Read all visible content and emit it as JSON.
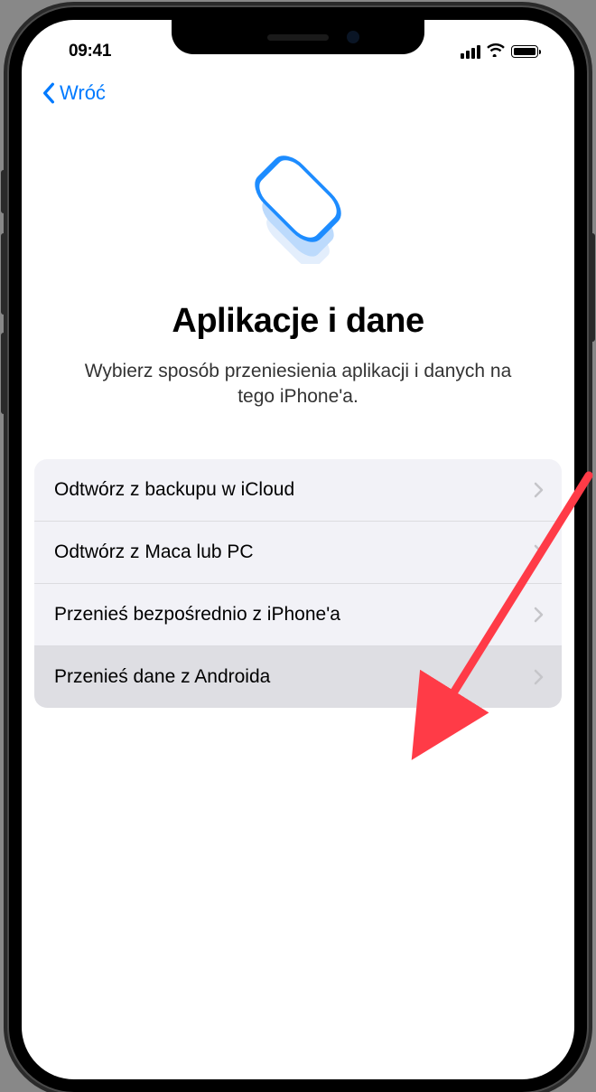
{
  "status_bar": {
    "time": "09:41"
  },
  "nav": {
    "back_label": "Wróć"
  },
  "page": {
    "title": "Aplikacje i dane",
    "subtitle": "Wybierz sposób przeniesienia aplikacji i danych na tego iPhone'a."
  },
  "options": [
    {
      "label": "Odtwórz z backupu w iCloud",
      "highlighted": false
    },
    {
      "label": "Odtwórz z Maca lub PC",
      "highlighted": false
    },
    {
      "label": "Przenieś bezpośrednio z iPhone'a",
      "highlighted": false
    },
    {
      "label": "Przenieś dane z Androida",
      "highlighted": true
    }
  ],
  "colors": {
    "accent": "#007aff",
    "annotation": "#ff3b47"
  }
}
